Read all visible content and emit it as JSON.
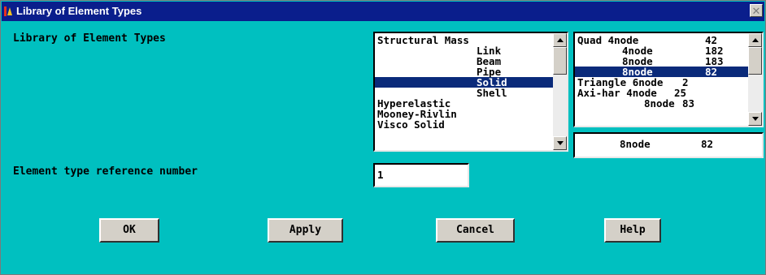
{
  "window": {
    "title": "Library of Element Types",
    "title_icon": "ansys-logo-icon",
    "close_icon": "close-icon",
    "close_glyph": "✕"
  },
  "form": {
    "library_label": "Library of Element Types",
    "category_list": {
      "items": [
        "Structural Mass",
        "Link",
        "Beam",
        "Pipe",
        "Solid",
        "Shell",
        "Hyperelastic",
        "Mooney-Rivlin",
        "Visco Solid"
      ],
      "selected": "Solid"
    },
    "element_list": {
      "items": [
        {
          "name": "Quad 4node",
          "num": "42"
        },
        {
          "name": "4node",
          "num": "182"
        },
        {
          "name": "8node",
          "num": "183"
        },
        {
          "name": "8node",
          "num": "82"
        },
        {
          "name": "Triangle 6node",
          "num": "2"
        },
        {
          "name": "Axi-har 4node",
          "num": "25"
        },
        {
          "name": "8node",
          "num": "83"
        }
      ],
      "selected_index": 3
    },
    "selection_display": {
      "name": "8node",
      "num": "82"
    },
    "ref_number_label": "Element type reference number",
    "ref_number_value": "1"
  },
  "buttons": {
    "ok": "OK",
    "apply": "Apply",
    "cancel": "Cancel",
    "help": "Help"
  },
  "colors": {
    "dialog_background": "#00c0c0",
    "titlebar": "#0a1e8c",
    "selection": "#0a2a7a"
  }
}
